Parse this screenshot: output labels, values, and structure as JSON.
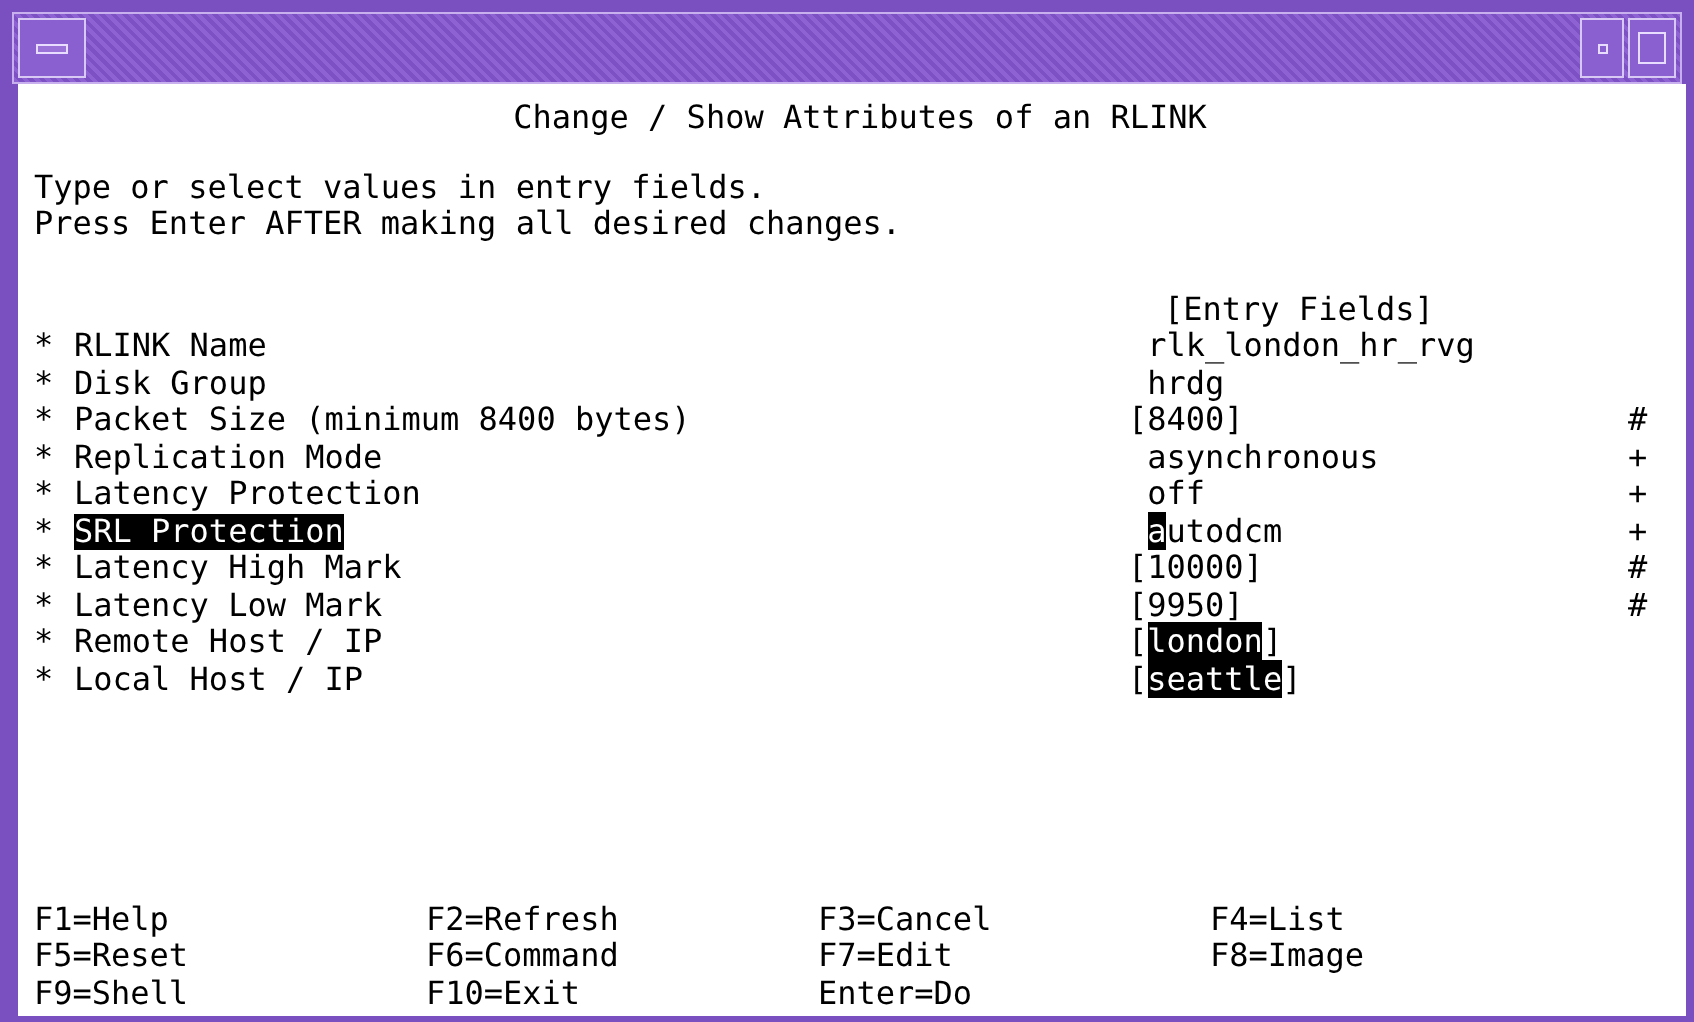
{
  "screen": {
    "title": "Change / Show Attributes of an RLINK",
    "instructions": [
      "Type or select values in entry fields.",
      "Press Enter AFTER making all desired changes."
    ],
    "column_header": "[Entry Fields]",
    "fields": [
      {
        "required": "*",
        "label": "RLINK Name",
        "selected": false,
        "value": "rlk_london_hr_rvg",
        "highlighted": false,
        "cursor": false
      },
      {
        "required": "*",
        "label": "Disk Group",
        "selected": false,
        "value": "hrdg",
        "highlighted": false,
        "cursor": false
      },
      {
        "required": "*",
        "label": "Packet Size (minimum 8400 bytes)",
        "selected": false,
        "open": "[",
        "value": "8400",
        "close": "]",
        "highlighted": false,
        "cursor": false,
        "marker": "#"
      },
      {
        "required": "*",
        "label": "Replication Mode",
        "selected": false,
        "value": "asynchronous",
        "highlighted": false,
        "cursor": false,
        "marker": "+"
      },
      {
        "required": "*",
        "label": "Latency Protection",
        "selected": false,
        "value": "off",
        "highlighted": false,
        "cursor": false,
        "marker": "+"
      },
      {
        "required": "*",
        "label": "SRL Protection",
        "selected": true,
        "value": "autodcm",
        "highlighted": false,
        "cursor": true,
        "marker": "+"
      },
      {
        "required": "*",
        "label": "Latency High Mark",
        "selected": false,
        "open": "[",
        "value": "10000",
        "close": "]",
        "highlighted": false,
        "cursor": false,
        "marker": "#"
      },
      {
        "required": "*",
        "label": "Latency Low Mark",
        "selected": false,
        "open": "[",
        "value": "9950",
        "close": "]",
        "highlighted": false,
        "cursor": false,
        "marker": "#"
      },
      {
        "required": "*",
        "label": "Remote Host / IP",
        "selected": false,
        "open": "[",
        "value": "london",
        "close": "]",
        "highlighted": true,
        "cursor": false
      },
      {
        "required": "*",
        "label": "Local Host / IP",
        "selected": false,
        "open": "[",
        "value": "seattle",
        "close": "]",
        "highlighted": true,
        "cursor": false
      }
    ]
  },
  "function_keys": [
    [
      "F1=Help",
      "F2=Refresh",
      "F3=Cancel",
      "F4=List"
    ],
    [
      "F5=Reset",
      "F6=Command",
      "F7=Edit",
      "F8=Image"
    ],
    [
      "F9=Shell",
      "F10=Exit",
      "Enter=Do"
    ]
  ]
}
